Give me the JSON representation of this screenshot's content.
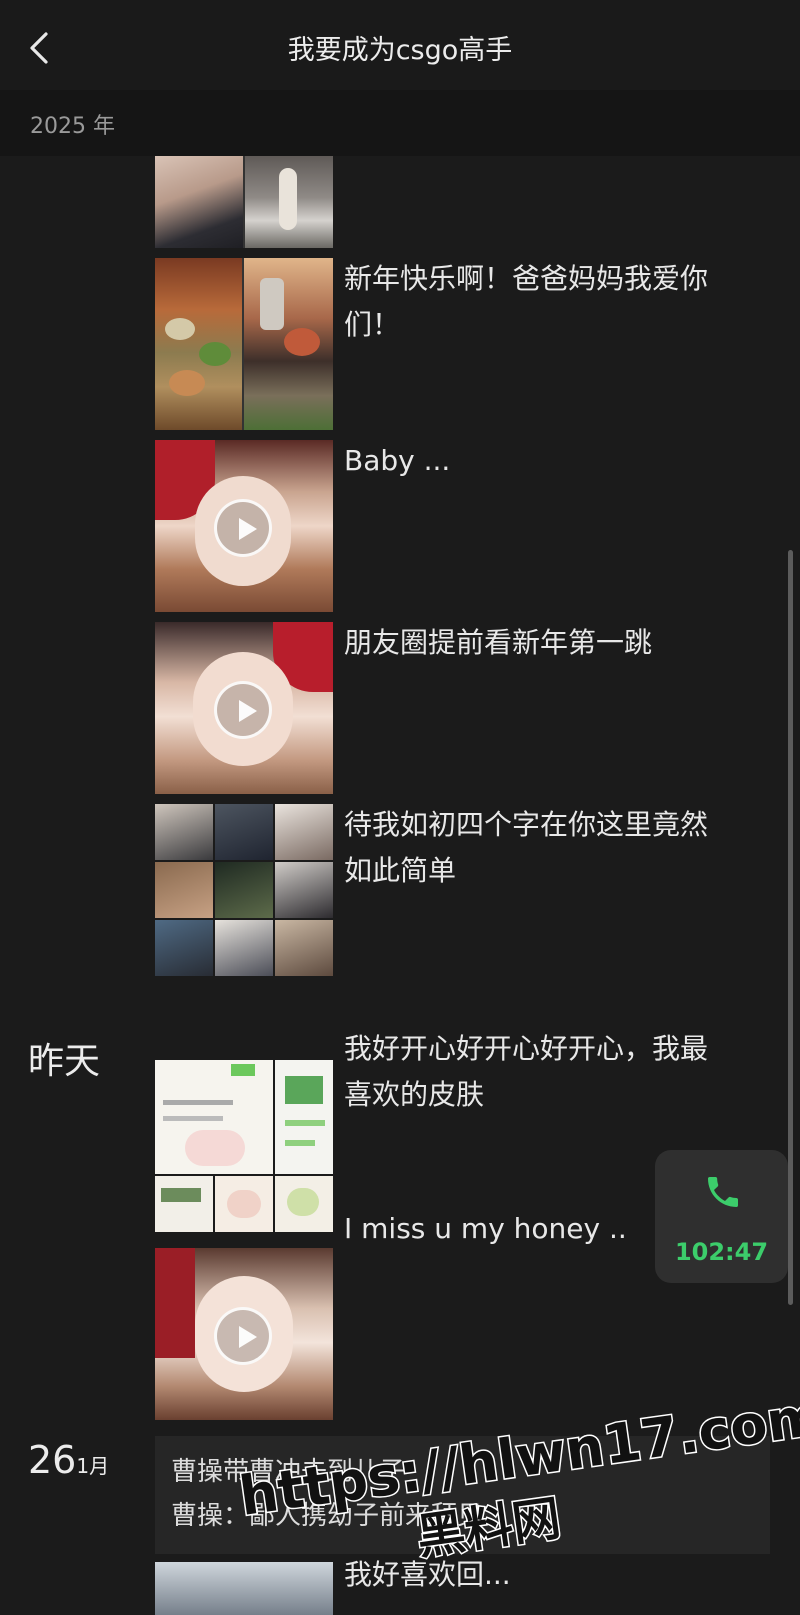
{
  "header": {
    "title": "我要成为csgo高手"
  },
  "year_bar": {
    "label": "2025 年"
  },
  "posts": [
    {
      "caption": ""
    },
    {
      "caption": "新年快乐啊！爸爸妈妈我爱你们！"
    },
    {
      "caption": "Baby ..."
    },
    {
      "caption": "朋友圈提前看新年第一跳"
    },
    {
      "caption": "待我如初四个字在你这里竟然如此简单"
    },
    {
      "caption": "我好开心好开心好开心，我最喜欢的皮肤"
    },
    {
      "caption": "I miss u my honey .."
    }
  ],
  "dates": {
    "yesterday": "昨天",
    "day26_num": "26",
    "day26_month": "1月"
  },
  "text_post": {
    "line1": "曹操带曹冲去到儿子",
    "line2": "曹操：鄙人携幼子前来拜见..."
  },
  "partial_post": {
    "caption": "我好喜欢回..."
  },
  "call": {
    "time": "102:47",
    "color": "#3ccd6b"
  },
  "watermark": {
    "url": "https://hlwn17.com",
    "name": "黑料网"
  },
  "icons": {
    "back": "chevron-left-icon",
    "call": "phone-icon",
    "play": "play-icon"
  }
}
